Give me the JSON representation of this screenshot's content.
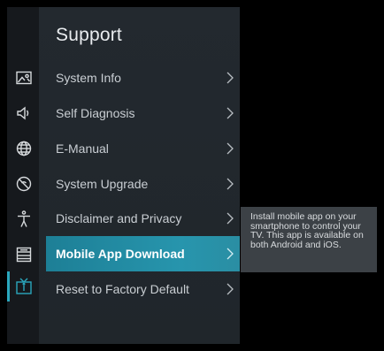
{
  "menu": {
    "title": "Support",
    "items": [
      {
        "label": "System Info",
        "icon": "picture-settings-icon"
      },
      {
        "label": "Self Diagnosis",
        "icon": "speaker-icon"
      },
      {
        "label": "E-Manual",
        "icon": "globe-icon"
      },
      {
        "label": "System Upgrade",
        "icon": "no-signal-icon"
      },
      {
        "label": "Disclaimer and Privacy",
        "icon": "accessibility-icon"
      },
      {
        "label": "Mobile App Download",
        "icon": "list-icon"
      },
      {
        "label": "Reset to Factory Default",
        "icon": "tv-support-icon"
      }
    ],
    "active_index": 5
  },
  "tooltip": {
    "text": "Install mobile app on your smartphone to control your TV. This app is available on both Android and iOS."
  },
  "colors": {
    "accent": "#2aa7bd",
    "active_row": "#2795ad",
    "panel": "#23292f",
    "rail": "#16191d",
    "tooltip_bg": "#3c4146"
  }
}
